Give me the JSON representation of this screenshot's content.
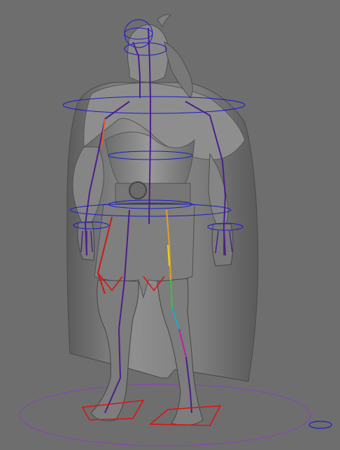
{
  "viewport": {
    "background": "#6e6e6e",
    "mesh_color": "#8a8a8a",
    "mesh_shadow": "#4a4a4a",
    "rig_colors": {
      "spine": "#4b1f8a",
      "control_blue": "#1a1ad0",
      "ground_circle": "#8a3fc0",
      "foot_control": "#e01010",
      "leg_red": "#d01818",
      "leg_yellow": "#e6d21a",
      "leg_green": "#40c040",
      "leg_cyan": "#20a8c8",
      "leg_magenta": "#c020a0",
      "arm_orange": "#e06020"
    },
    "icons": [
      "character-mesh",
      "skeleton-joints",
      "ground-control-circle",
      "foot-controls",
      "hip-control",
      "shoulder-control",
      "head-control",
      "small-view-marker"
    ]
  }
}
